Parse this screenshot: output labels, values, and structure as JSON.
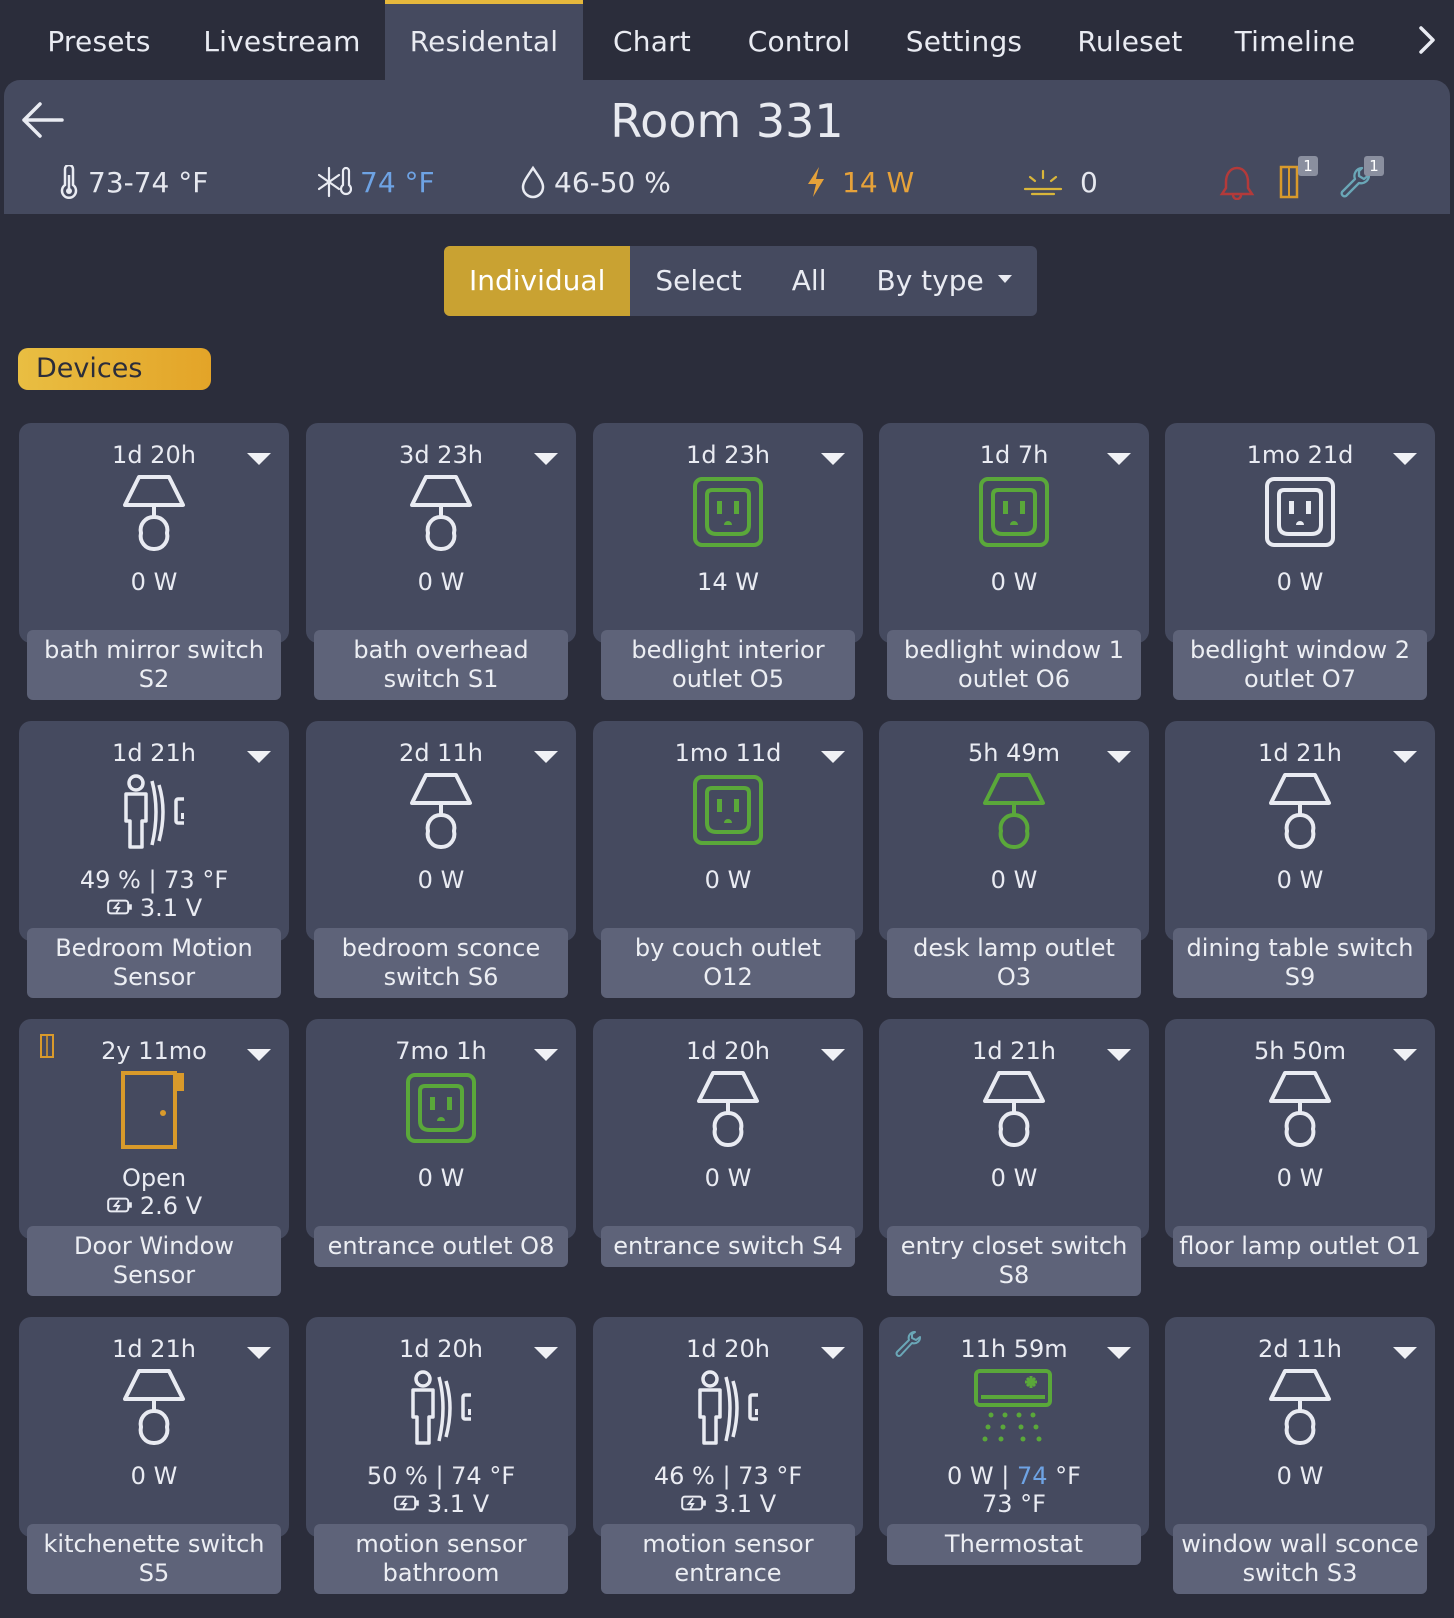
{
  "tabs": [
    "Presets",
    "Livestream",
    "Residental",
    "Chart",
    "Control",
    "Settings",
    "Ruleset",
    "Timeline"
  ],
  "header": {
    "title": "Room 331",
    "temperature": "73-74 °F",
    "setpoint": "74 °F",
    "humidity": "46-50 %",
    "power": "14 W",
    "light": "0",
    "door_badge": "1",
    "wrench_badge": "1"
  },
  "modes": {
    "individual": "Individual",
    "select": "Select",
    "all": "All",
    "by_type": "By type"
  },
  "section": "Devices",
  "colors": {
    "accent": "#e6b83c",
    "card": "#454a5f",
    "label": "#5e6379",
    "green": "#5aa83a",
    "blue": "#6ea3e4",
    "orange": "#e6a23a"
  },
  "devices": [
    {
      "time": "1d 20h",
      "icon": "lamp-icon",
      "l1": "0 W",
      "name": "bath mirror switch S2"
    },
    {
      "time": "3d 23h",
      "icon": "lamp-icon",
      "l1": "0 W",
      "name": "bath overhead switch S1"
    },
    {
      "time": "1d 23h",
      "icon": "outlet-icon-on",
      "l1": "14 W",
      "name": "bedlight interior outlet O5"
    },
    {
      "time": "1d 7h",
      "icon": "outlet-icon-on",
      "l1": "0 W",
      "name": "bedlight window 1 outlet O6"
    },
    {
      "time": "1mo 21d",
      "icon": "outlet-icon",
      "l1": "0 W",
      "name": "bedlight window 2 outlet O7"
    },
    {
      "time": "1d 21h",
      "icon": "motion-sensor-icon",
      "l1": "49 % | 73 °F",
      "l2": "3.1 V",
      "name": "Bedroom Motion Sensor"
    },
    {
      "time": "2d 11h",
      "icon": "lamp-icon",
      "l1": "0 W",
      "name": "bedroom sconce switch S6"
    },
    {
      "time": "1mo 11d",
      "icon": "outlet-icon-on",
      "l1": "0 W",
      "name": "by couch outlet O12"
    },
    {
      "time": "5h 49m",
      "icon": "lamp-icon-on",
      "l1": "0 W",
      "name": "desk lamp outlet O3"
    },
    {
      "time": "1d 21h",
      "icon": "lamp-icon",
      "l1": "0 W",
      "name": "dining table switch S9"
    },
    {
      "time": "2y 11mo",
      "icon": "door-icon",
      "l1": "Open",
      "l2": "2.6 V",
      "name": "Door Window Sensor"
    },
    {
      "time": "7mo 1h",
      "icon": "outlet-icon-on",
      "l1": "0 W",
      "name": "entrance outlet O8"
    },
    {
      "time": "1d 20h",
      "icon": "lamp-icon",
      "l1": "0 W",
      "name": "entrance switch S4"
    },
    {
      "time": "1d 21h",
      "icon": "lamp-icon",
      "l1": "0 W",
      "name": "entry closet switch S8"
    },
    {
      "time": "5h 50m",
      "icon": "lamp-icon",
      "l1": "0 W",
      "name": "floor lamp outlet O1"
    },
    {
      "time": "1d 21h",
      "icon": "lamp-icon",
      "l1": "0 W",
      "name": "kitchenette switch S5"
    },
    {
      "time": "1d 20h",
      "icon": "motion-sensor-icon",
      "l1": "50 % | 74 °F",
      "l2": "3.1 V",
      "name": "motion sensor bathroom"
    },
    {
      "time": "1d 20h",
      "icon": "motion-sensor-icon",
      "l1": "46 % | 73 °F",
      "l2": "3.1 V",
      "name": "motion sensor entrance"
    },
    {
      "time": "11h 59m",
      "icon": "ac-unit-icon",
      "l1a": "0 W | ",
      "l1b": "74",
      "l1c": " °F",
      "l2": "73 °F",
      "name": "Thermostat"
    },
    {
      "time": "2d 11h",
      "icon": "lamp-icon",
      "l1": "0 W",
      "name": "window wall sconce switch S3"
    }
  ]
}
